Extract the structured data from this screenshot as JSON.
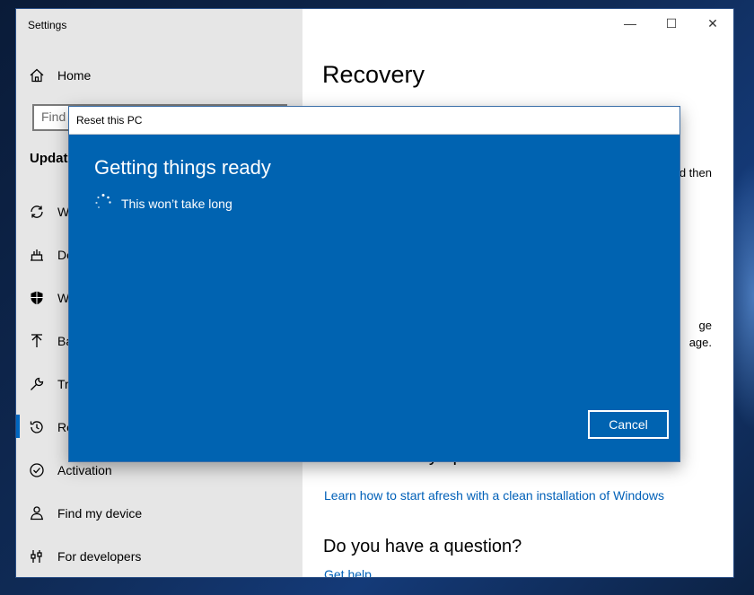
{
  "window": {
    "title": "Settings",
    "controls": {
      "minimize": "—",
      "maximize": "☐",
      "close": "✕"
    }
  },
  "sidebar": {
    "home_label": "Home",
    "search_placeholder": "Find",
    "section_heading": "Update",
    "items": [
      {
        "label": "W",
        "icon": "sync-icon"
      },
      {
        "label": "De",
        "icon": "delivery-icon"
      },
      {
        "label": "W",
        "icon": "shield-icon"
      },
      {
        "label": "Ba",
        "icon": "backup-icon"
      },
      {
        "label": "Tr",
        "icon": "wrench-icon"
      },
      {
        "label": "Re",
        "icon": "recovery-icon"
      },
      {
        "label": "Activation",
        "icon": "checkmark-circle-icon"
      },
      {
        "label": "Find my device",
        "icon": "person-locate-icon"
      },
      {
        "label": "For developers",
        "icon": "developer-icon"
      }
    ]
  },
  "main": {
    "title": "Recovery",
    "peek_text_1": "d then",
    "peek_text_2a": "ge",
    "peek_text_2b": "age.",
    "more_heading": "More recovery options",
    "more_link": "Learn how to start afresh with a clean installation of Windows",
    "question_heading": "Do you have a question?",
    "help_link": "Get help"
  },
  "dialog": {
    "title": "Reset this PC",
    "heading": "Getting things ready",
    "subtext": "This won’t take long",
    "cancel_label": "Cancel"
  },
  "colors": {
    "dialog_bg": "#0063b1",
    "accent": "#0067c0",
    "link": "#0060b8",
    "sidebar_bg": "#e6e6e6"
  }
}
